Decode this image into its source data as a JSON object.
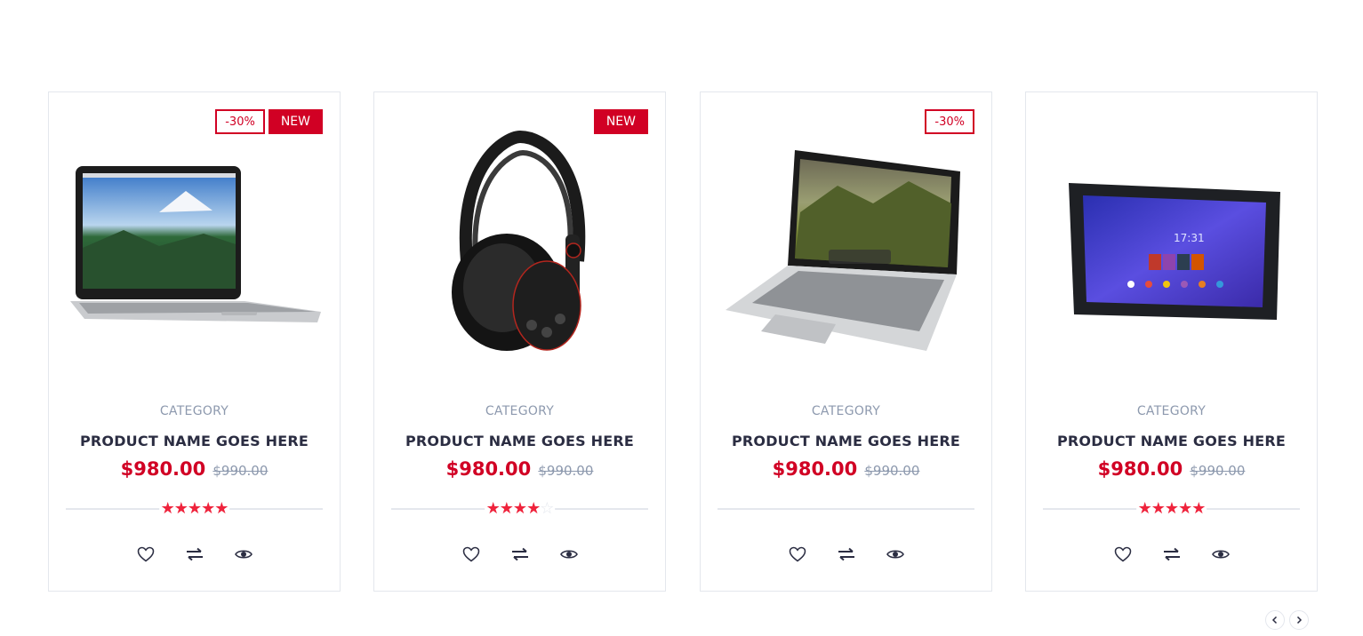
{
  "products": [
    {
      "image_icon": "laptop-icon",
      "labels": {
        "sale": "-30%",
        "new": "NEW"
      },
      "category": "CATEGORY",
      "name": "PRODUCT NAME GOES HERE",
      "price": "$980.00",
      "old_price": "$990.00",
      "rating": 5
    },
    {
      "image_icon": "headphones-icon",
      "labels": {
        "new": "NEW"
      },
      "category": "CATEGORY",
      "name": "PRODUCT NAME GOES HERE",
      "price": "$980.00",
      "old_price": "$990.00",
      "rating": 4
    },
    {
      "image_icon": "laptop-icon",
      "labels": {
        "sale": "-30%"
      },
      "category": "CATEGORY",
      "name": "PRODUCT NAME GOES HERE",
      "price": "$980.00",
      "old_price": "$990.00",
      "rating": 0
    },
    {
      "image_icon": "tablet-icon",
      "labels": {},
      "category": "CATEGORY",
      "name": "PRODUCT NAME GOES HERE",
      "price": "$980.00",
      "old_price": "$990.00",
      "rating": 5
    }
  ],
  "actions": [
    "heart-icon",
    "exchange-icon",
    "eye-icon"
  ],
  "slider_nav": {
    "prev_icon": "chevron-left-icon",
    "next_icon": "chevron-right-icon"
  },
  "colors": {
    "accent": "#D10024",
    "star": "#ef233c",
    "text": "#2B2D42",
    "muted": "#8d99ae",
    "border": "#e4e7ed"
  }
}
